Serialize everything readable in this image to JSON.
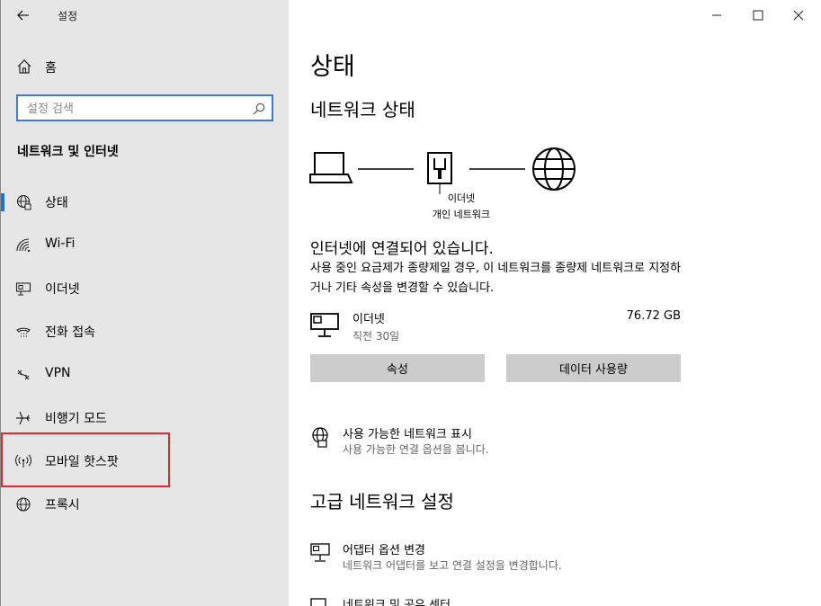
{
  "window": {
    "title": "설정"
  },
  "sidebar": {
    "home_label": "홈",
    "search_placeholder": "설정 검색",
    "section_title": "네트워크 및 인터넷",
    "items": [
      {
        "label": "상태",
        "icon": "globe-status-icon",
        "selected": true
      },
      {
        "label": "Wi-Fi",
        "icon": "wifi-icon"
      },
      {
        "label": "이더넷",
        "icon": "ethernet-icon"
      },
      {
        "label": "전화 접속",
        "icon": "dial-up-icon"
      },
      {
        "label": "VPN",
        "icon": "vpn-icon"
      },
      {
        "label": "비행기 모드",
        "icon": "airplane-icon"
      },
      {
        "label": "모바일 핫스팟",
        "icon": "hotspot-icon"
      },
      {
        "label": "프록시",
        "icon": "globe-icon"
      }
    ]
  },
  "main": {
    "title": "상태",
    "network_status_heading": "네트워크 상태",
    "diagram": {
      "line1": "이더넷",
      "line2": "개인 네트워크"
    },
    "connected_text": "인터넷에 연결되어 있습니다.",
    "description": "사용 중인 요금제가 종량제일 경우, 이 네트워크를 종량제 네트워크로 지정하거나 기타 속성을 변경할 수 있습니다.",
    "connection": {
      "name": "이더넷",
      "subtitle": "직전 30일",
      "usage": "76.72 GB"
    },
    "buttons": {
      "properties": "속성",
      "data_usage": "데이터 사용량"
    },
    "show_networks": {
      "title": "사용 가능한 네트워크 표시",
      "subtitle": "사용 가능한 연결 옵션을 봅니다."
    },
    "advanced_heading": "고급 네트워크 설정",
    "adapter_options": {
      "title": "어댑터 옵션 변경",
      "subtitle": "네트워크 어댑터를 보고 연결 설정을 변경합니다."
    },
    "sharing_center": {
      "title": "네트워크 및 공유 센터"
    }
  },
  "colors": {
    "accent": "#1f6fd1",
    "sidebar_bg": "#e6e6e6",
    "highlight": "#e0262e",
    "button_bg": "#cccccc"
  }
}
